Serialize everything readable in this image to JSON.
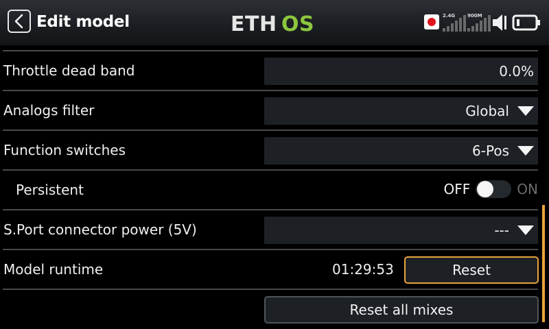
{
  "header": {
    "title": "Edit model",
    "logo_text": "ETHOS",
    "signal_24_label": "2.4G",
    "signal_900_label": "900M"
  },
  "rows": {
    "throttle_dead_band": {
      "label": "Throttle dead band",
      "value": "0.0%"
    },
    "analogs_filter": {
      "label": "Analogs filter",
      "value": "Global"
    },
    "function_switches": {
      "label": "Function switches",
      "value": "6-Pos"
    },
    "persistent": {
      "label": "Persistent",
      "off_label": "OFF",
      "on_label": "ON",
      "state": "off"
    },
    "sport_power": {
      "label": "S.Port connector power (5V)",
      "value": "---"
    },
    "model_runtime": {
      "label": "Model runtime",
      "value": "01:29:53",
      "reset_label": "Reset"
    },
    "reset_all_mixes": {
      "label": "Reset all mixes"
    }
  },
  "colors": {
    "accent": "#e9a43a",
    "logo_green": "#8cc63e",
    "record": "#e0141c"
  },
  "icons": [
    "back-arrow-icon",
    "record-icon",
    "signal-2-4g-icon",
    "signal-900m-icon",
    "speaker-icon",
    "battery-icon",
    "dropdown-caret-icon"
  ]
}
